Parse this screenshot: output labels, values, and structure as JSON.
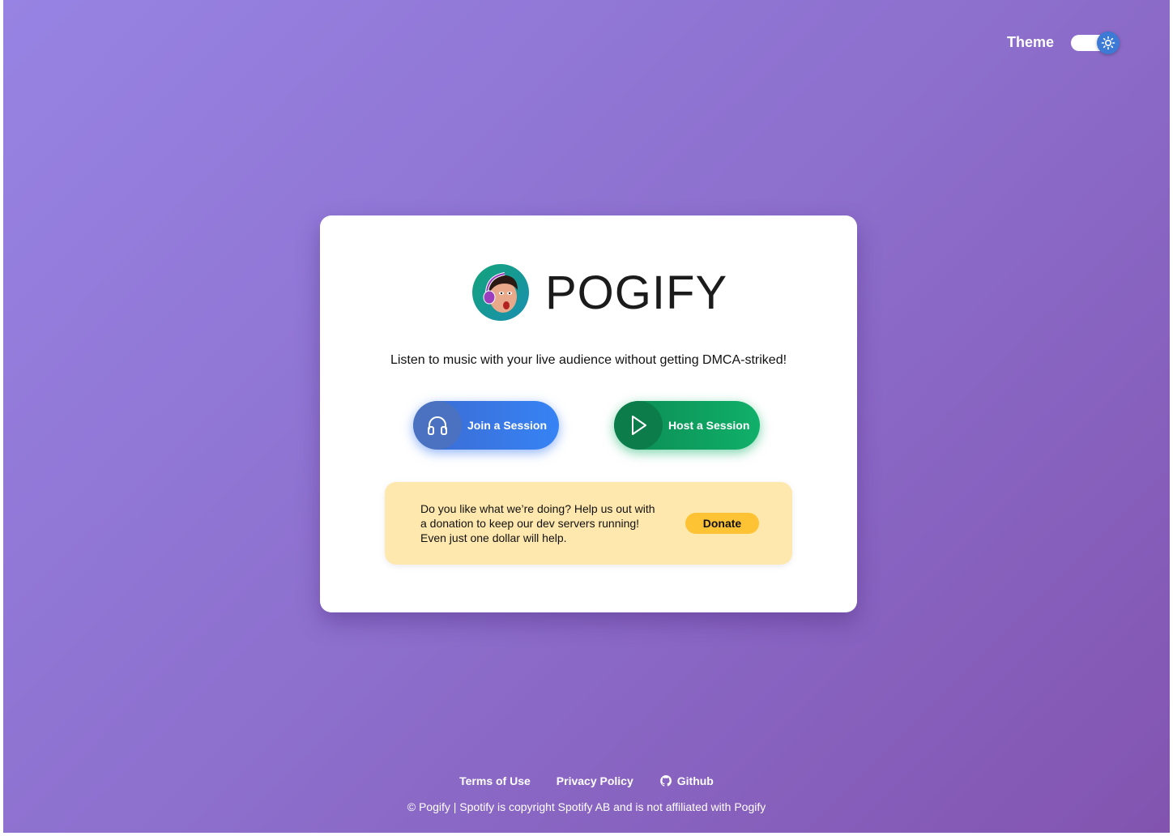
{
  "header": {
    "theme_label": "Theme"
  },
  "brand": {
    "name": "POGIFY"
  },
  "tagline": "Listen to music with your live audience without getting DMCA-striked!",
  "actions": {
    "join_label": "Join a Session",
    "host_label": "Host a Session"
  },
  "donate": {
    "text": "Do you like what we’re doing? Help us out with a donation to keep our dev servers running! Even just one dollar will help.",
    "button_label": "Donate"
  },
  "footer": {
    "terms": "Terms of Use",
    "privacy": "Privacy Policy",
    "github": "Github",
    "copyright": "© Pogify | Spotify is copyright Spotify AB and is not affiliated with Pogify"
  },
  "icons": {
    "theme_knob": "sun-icon",
    "join": "headphones-icon",
    "host": "play-icon",
    "github": "github-icon"
  },
  "colors": {
    "join_button": "#3683f5",
    "host_button": "#10b06a",
    "donate_bg": "#ffe8ad",
    "donate_button": "#fdc334"
  }
}
